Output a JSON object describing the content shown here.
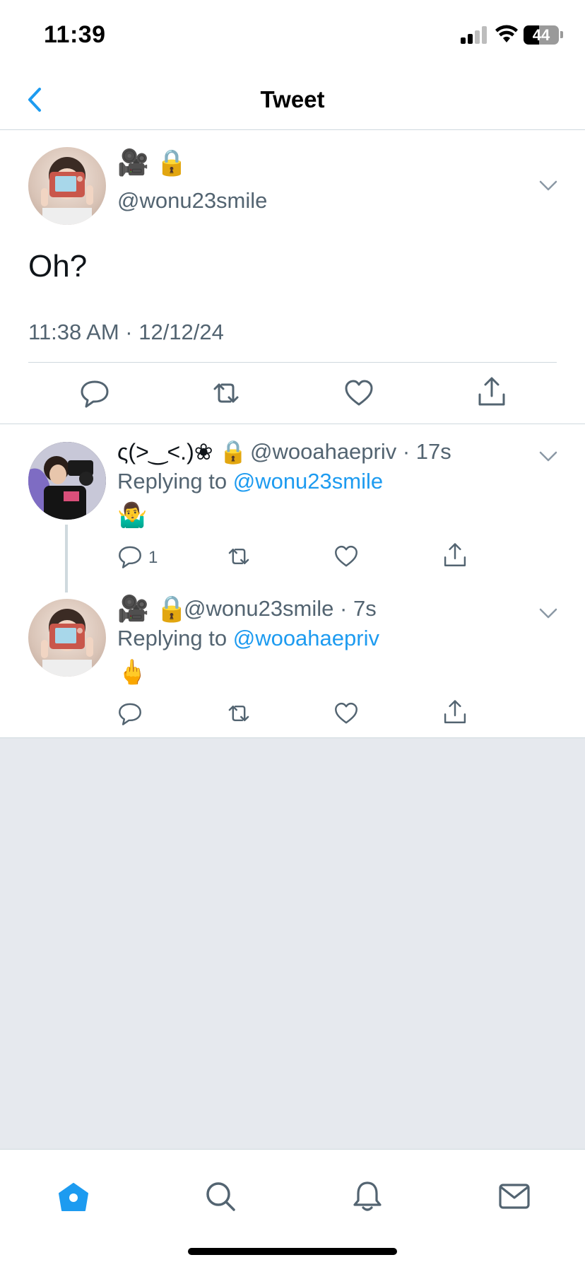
{
  "status_bar": {
    "time": "11:39",
    "battery": "44",
    "battery_level": 0.44
  },
  "nav": {
    "back_icon": "chevron-left-icon",
    "title": "Tweet",
    "accent": "#1d9bf0"
  },
  "main_tweet": {
    "name": "🎥 🔒",
    "handle": "@wonu23smile",
    "text": "Oh?",
    "timestamp": "11:38 AM · 12/12/24",
    "actions": [
      "reply-icon",
      "retweet-icon",
      "like-icon",
      "share-icon"
    ]
  },
  "replies": [
    {
      "name": "ς(>‿<.)❀ 🔒",
      "meta": "@wooahaepriv · 17s",
      "replying_prefix": "Replying to ",
      "replying_handle": "@wonu23smile",
      "content": "🤷‍♂️",
      "reply_count": "1"
    },
    {
      "name": "🎥 🔒",
      "meta": "@wonu23smile · 7s",
      "replying_prefix": "Replying to ",
      "replying_handle": "@wooahaepriv",
      "content": "🖕"
    }
  ],
  "tabbar": {
    "tabs": [
      "home-icon",
      "search-icon",
      "notifications-icon",
      "messages-icon"
    ],
    "active": "home-icon"
  }
}
